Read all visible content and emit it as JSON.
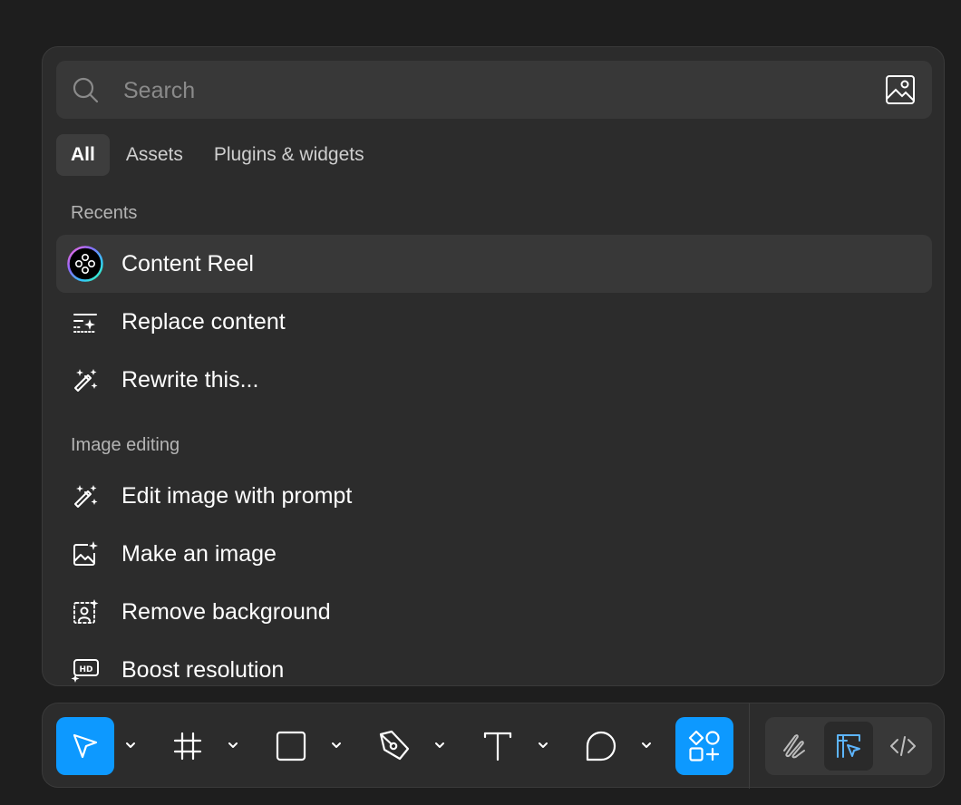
{
  "search": {
    "placeholder": "Search",
    "value": "",
    "image_search_icon": "image-search-icon"
  },
  "tabs": [
    {
      "label": "All",
      "active": true
    },
    {
      "label": "Assets",
      "active": false
    },
    {
      "label": "Plugins & widgets",
      "active": false
    }
  ],
  "recents": {
    "title": "Recents",
    "items": [
      {
        "label": "Content Reel",
        "icon": "content-reel-icon",
        "highlighted": true
      },
      {
        "label": "Replace content",
        "icon": "replace-content-icon",
        "highlighted": false
      },
      {
        "label": "Rewrite this...",
        "icon": "magic-wand-icon",
        "highlighted": false
      }
    ]
  },
  "image_editing": {
    "title": "Image editing",
    "items": [
      {
        "label": "Edit image with prompt",
        "icon": "magic-wand-icon"
      },
      {
        "label": "Make an image",
        "icon": "image-sparkle-icon"
      },
      {
        "label": "Remove background",
        "icon": "remove-background-icon"
      },
      {
        "label": "Boost resolution",
        "icon": "hd-icon"
      }
    ]
  },
  "toolbar": {
    "tools": [
      {
        "name": "move",
        "icon": "cursor-icon",
        "selected": true
      },
      {
        "name": "frame",
        "icon": "frame-icon",
        "selected": false
      },
      {
        "name": "rectangle",
        "icon": "rectangle-icon",
        "selected": false
      },
      {
        "name": "pen",
        "icon": "pen-icon",
        "selected": false
      },
      {
        "name": "text",
        "icon": "text-icon",
        "selected": false
      },
      {
        "name": "comment",
        "icon": "comment-icon",
        "selected": false
      },
      {
        "name": "actions",
        "icon": "actions-icon",
        "selected": true
      }
    ],
    "modes": [
      {
        "name": "draw",
        "icon": "draw-icon",
        "active": false
      },
      {
        "name": "design",
        "icon": "design-icon",
        "active": true
      },
      {
        "name": "dev",
        "icon": "code-icon",
        "active": false
      }
    ]
  },
  "colors": {
    "background": "#1e1e1e",
    "panel": "#2c2c2c",
    "accent": "#0d99ff",
    "highlight": "#383838",
    "muted_text": "#b4b4b4"
  }
}
